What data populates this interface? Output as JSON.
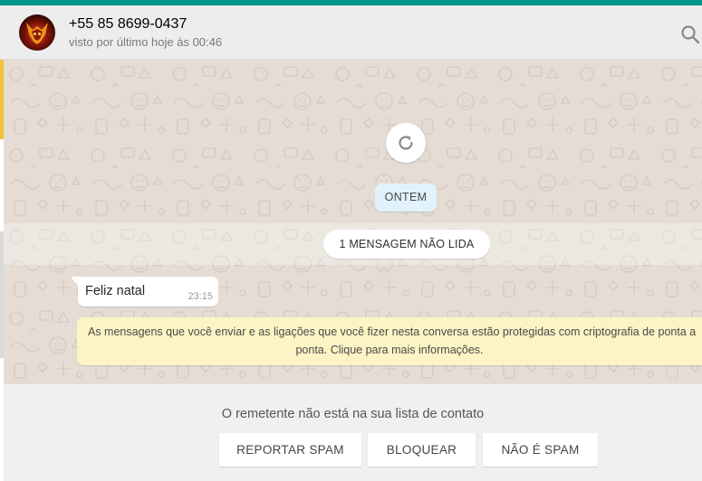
{
  "header": {
    "contact_name": "+55 85 8699-0437",
    "last_seen": "visto por último hoje às 00:46"
  },
  "chat": {
    "date_label": "ONTEM",
    "unread_label": "1 MENSAGEM NÃO LIDA",
    "messages": [
      {
        "text": "Feliz natal",
        "time": "23:15"
      }
    ],
    "encryption_notice": {
      "line1": "As mensagens que você enviar e as ligações que você fizer nesta conversa estão protegidas com criptografia de ponta a",
      "line2": "ponta. Clique para mais informações."
    }
  },
  "footer": {
    "not_contact_text": "O remetente não está na sua lista de contato",
    "report_spam": "REPORTAR SPAM",
    "block": "BLOQUEAR",
    "not_spam": "NÃO É SPAM"
  },
  "colors": {
    "accent": "#009688",
    "chat_bg": "#e5ddd5",
    "encryption_bg": "#fdf4c5",
    "date_chip_bg": "#e1f2fb"
  },
  "icons": [
    "avatar",
    "search-icon",
    "refresh-icon"
  ]
}
